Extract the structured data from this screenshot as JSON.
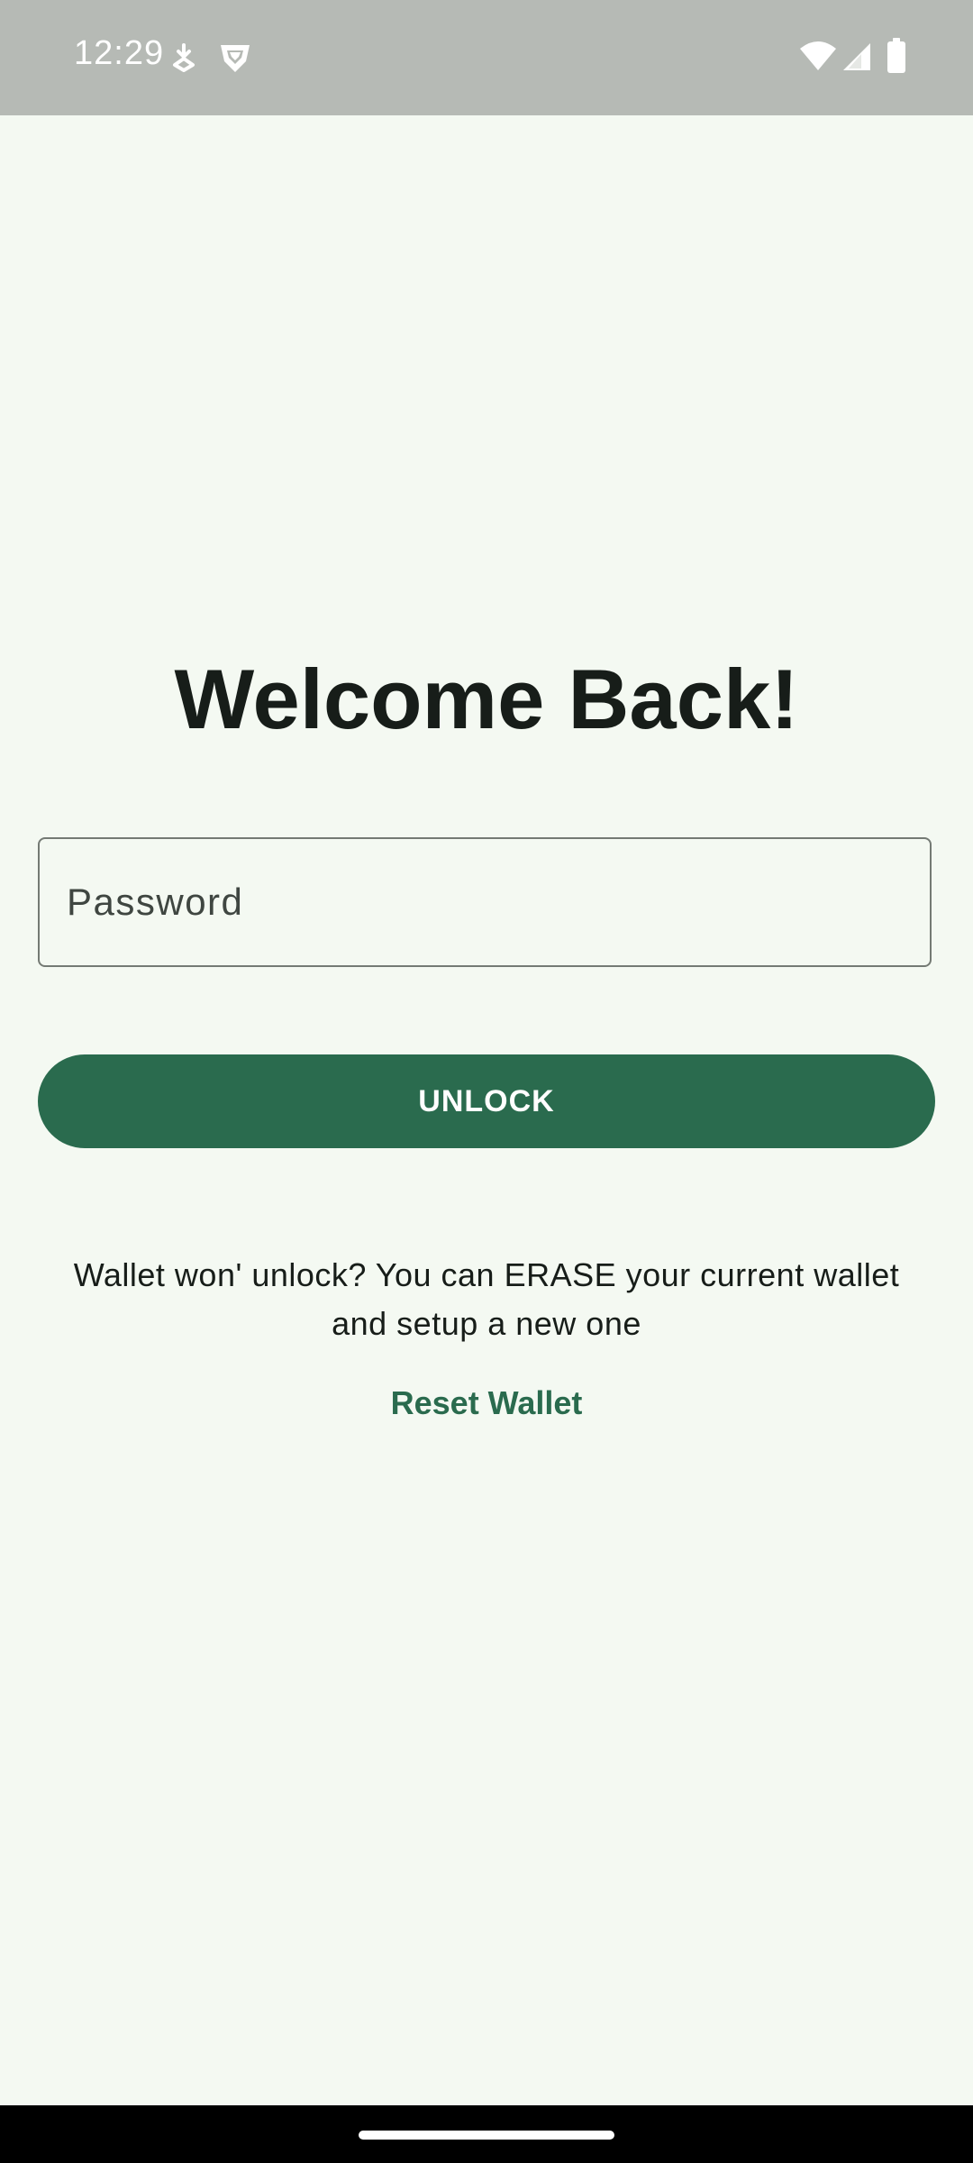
{
  "status_bar": {
    "time": "12:29",
    "icons": [
      "download-notification-icon",
      "shield-notification-icon",
      "wifi-icon",
      "cell-signal-icon",
      "battery-icon"
    ]
  },
  "main": {
    "title": "Welcome Back!",
    "password": {
      "placeholder": "Password",
      "value": ""
    },
    "unlock_label": "UNLOCK",
    "help_text": "Wallet won' unlock? You can ERASE your current wallet and setup a new one",
    "reset_label": "Reset Wallet"
  },
  "colors": {
    "background": "#f4f9f2",
    "status_bar": "#b6bab5",
    "accent": "#2a6b4e",
    "text": "#171d19",
    "field_border": "#747a74"
  }
}
